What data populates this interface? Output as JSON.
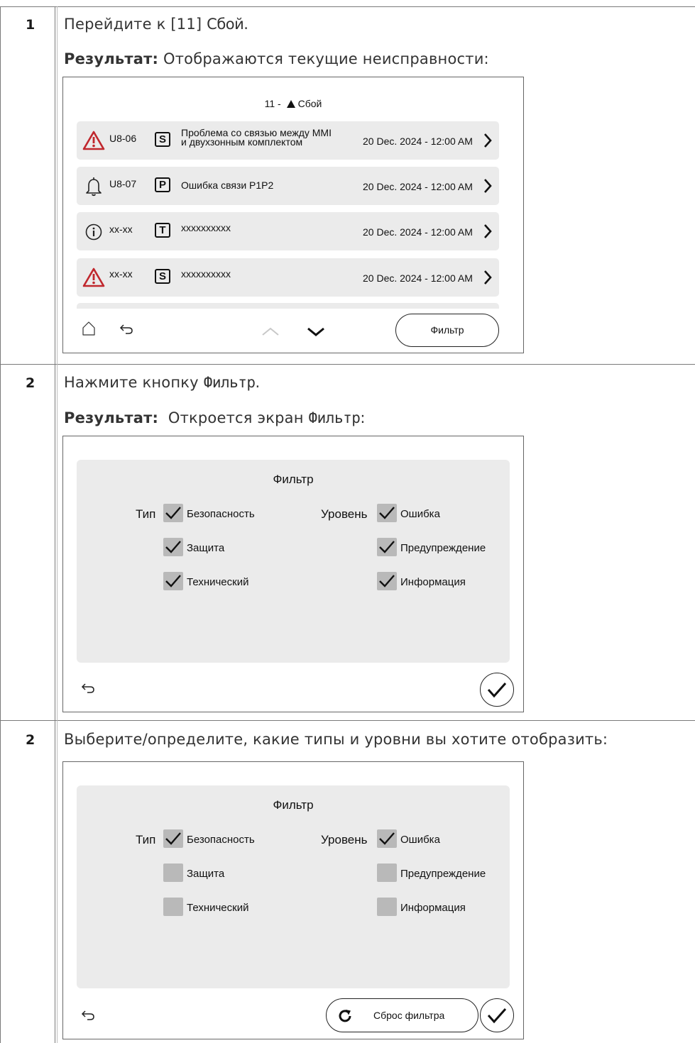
{
  "steps": [
    {
      "num": "1",
      "instruction_prefix": "Перейдите к [11] ",
      "instruction_term": "Сбой",
      "instruction_suffix": ".",
      "result_label": "Результат:",
      "result_text": " Отображаются текущие неисправности:"
    },
    {
      "num": "2",
      "instruction_prefix": "Нажмите кнопку ",
      "instruction_term": "Фильтр",
      "instruction_suffix": ".",
      "result_label": "Результат:",
      "result_text_prefix": "  Откроется экран ",
      "result_term": "Фильтр",
      "result_suffix": ":"
    },
    {
      "num": "2",
      "instruction": "Выберите/определите, какие типы и уровни вы хотите отобразить:"
    }
  ],
  "fault_screen": {
    "title_prefix": "11 - ",
    "title_text": "Сбой",
    "rows": [
      {
        "icon": "warning-triangle-icon",
        "code": "U8-06",
        "type": "S",
        "desc_line1": "Проблема со связью между MMI",
        "desc_line2": "и двухзонным комплектом",
        "date": "20 Dec. 2024 - 12:00 AM"
      },
      {
        "icon": "bell-icon",
        "code": "U8-07",
        "type": "P",
        "desc_line1": "Ошибка связи P1P2",
        "desc_line2": "",
        "date": "20 Dec. 2024 - 12:00 AM"
      },
      {
        "icon": "info-icon",
        "code": "xx-xx",
        "type": "T",
        "desc_line1": "xxxxxxxxxx",
        "desc_line2": "",
        "date": "20 Dec. 2024 - 12:00 AM"
      },
      {
        "icon": "warning-triangle-icon",
        "code": "xx-xx",
        "type": "S",
        "desc_line1": "xxxxxxxxxx",
        "desc_line2": "",
        "date": "20 Dec. 2024 - 12:00 AM"
      }
    ],
    "filter_button": "Фильтр"
  },
  "filter_screen_1": {
    "title": "Фильтр",
    "type_label": "Тип",
    "level_label": "Уровень",
    "types": [
      {
        "label": "Безопасность",
        "checked": true
      },
      {
        "label": "Защита",
        "checked": true
      },
      {
        "label": "Технический",
        "checked": true
      }
    ],
    "levels": [
      {
        "label": "Ошибка",
        "checked": true
      },
      {
        "label": "Предупреждение",
        "checked": true
      },
      {
        "label": "Информация",
        "checked": true
      }
    ]
  },
  "filter_screen_2": {
    "title": "Фильтр",
    "type_label": "Тип",
    "level_label": "Уровень",
    "types": [
      {
        "label": "Безопасность",
        "checked": true
      },
      {
        "label": "Защита",
        "checked": false
      },
      {
        "label": "Технический",
        "checked": false
      }
    ],
    "levels": [
      {
        "label": "Ошибка",
        "checked": true
      },
      {
        "label": "Предупреждение",
        "checked": false
      },
      {
        "label": "Информация",
        "checked": false
      }
    ],
    "reset_button": "Сброс фильтра"
  },
  "colors": {
    "warning_red": "#c0272d",
    "panel_gray": "#ebebeb",
    "checkbox_gray": "#b9b9b9"
  }
}
